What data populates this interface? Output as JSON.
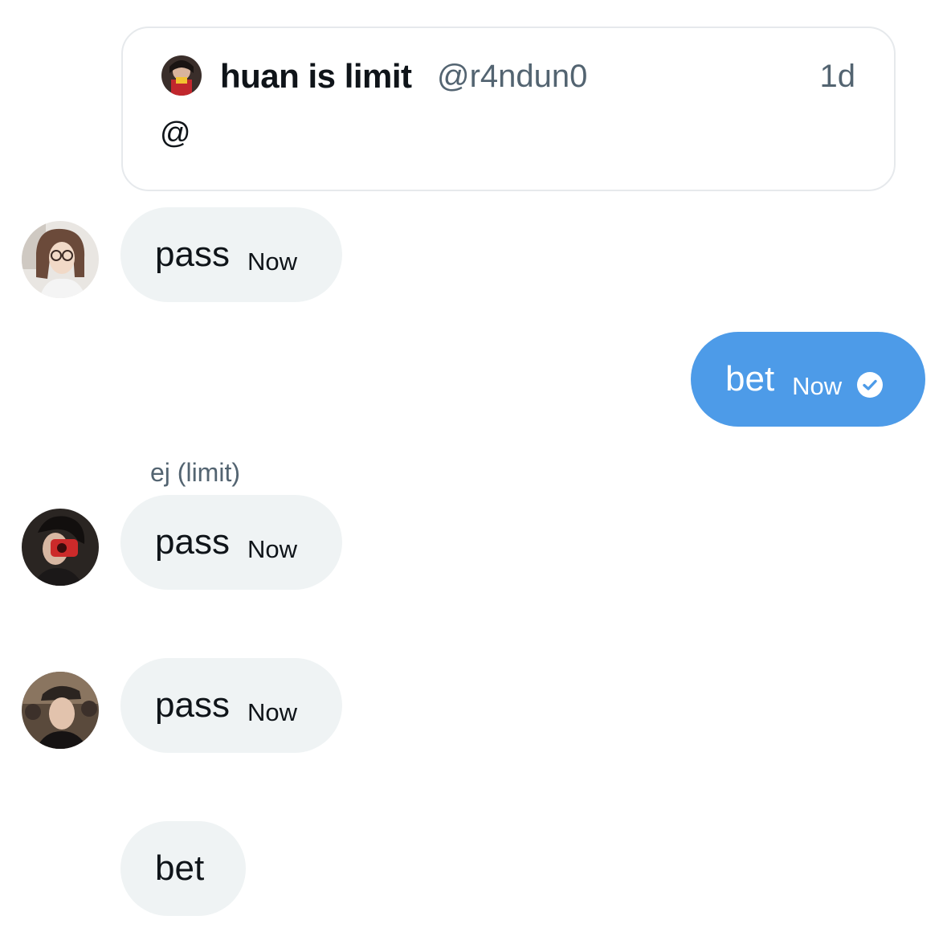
{
  "quoted_tweet": {
    "display_name": "huan is limit",
    "handle": "@r4ndun0",
    "time": "1d",
    "text": "@"
  },
  "messages": [
    {
      "sender": "",
      "text": "pass",
      "time": "Now",
      "direction": "incoming"
    },
    {
      "sender": "",
      "text": "bet",
      "time": "Now",
      "direction": "outgoing",
      "status_icon": "check-circle-icon"
    },
    {
      "sender": "ej (limit)",
      "text": "pass",
      "time": "Now",
      "direction": "incoming"
    },
    {
      "sender": "",
      "text": "pass",
      "time": "Now",
      "direction": "incoming"
    },
    {
      "sender": "",
      "text": "bet",
      "time": "",
      "direction": "incoming"
    }
  ],
  "colors": {
    "outgoing_bubble": "#4d9be8",
    "incoming_bubble": "#eff3f4",
    "secondary_text": "#536471"
  }
}
